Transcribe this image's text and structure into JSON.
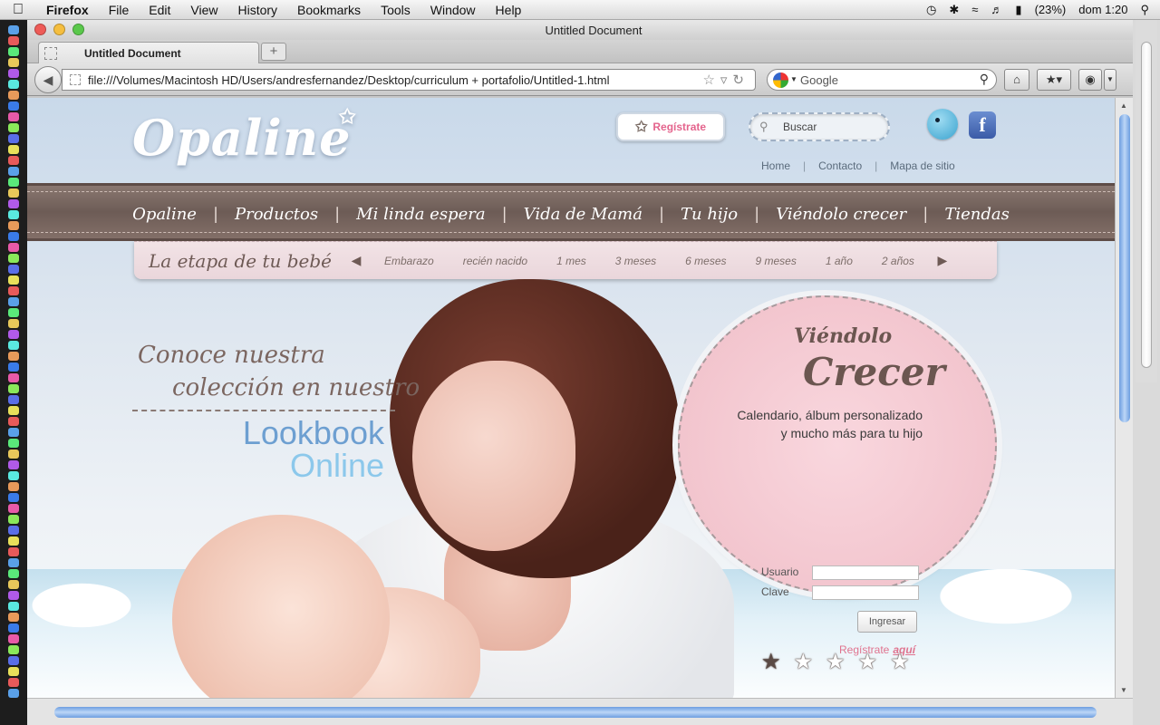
{
  "menubar": {
    "app": "Firefox",
    "items": [
      "File",
      "Edit",
      "View",
      "History",
      "Bookmarks",
      "Tools",
      "Window",
      "Help"
    ],
    "battery": "(23%)",
    "clock": "dom 1:20"
  },
  "browser": {
    "window_title": "Untitled Document",
    "tab_label": "Untitled Document",
    "url": "file:///Volumes/Macintosh HD/Users/andresfernandez/Desktop/curriculum + portafolio/Untitled-1.html",
    "search_placeholder": "Google"
  },
  "site": {
    "logo": "Opaline",
    "register_button": "Regístrate",
    "search_placeholder": "Buscar",
    "top_links": [
      "Home",
      "Contacto",
      "Mapa de sitio"
    ],
    "nav": [
      "Opaline",
      "Productos",
      "Mi linda espera",
      "Vida de Mamá",
      "Tu hijo",
      "Viéndolo crecer",
      "Tiendas"
    ],
    "stage_label": "La etapa de tu bebé",
    "stages": [
      "Embarazo",
      "recién nacido",
      "1 mes",
      "3 meses",
      "6 meses",
      "9 meses",
      "1 año",
      "2 años"
    ],
    "promo_line1": "Conoce nuestra",
    "promo_line2": "colección en nuestro",
    "lookbook": "Lookbook",
    "online": "Online",
    "login": {
      "title_small": "Viéndolo",
      "title_big": "Crecer",
      "desc_line1": "Calendario, álbum personalizado",
      "desc_line2": "y mucho más para tu hijo",
      "user_label": "Usuario",
      "pass_label": "Clave",
      "submit": "Ingresar",
      "register_text": "Regístrate",
      "register_link": "aquí"
    },
    "slider_dots": 5,
    "active_dot": 1
  }
}
